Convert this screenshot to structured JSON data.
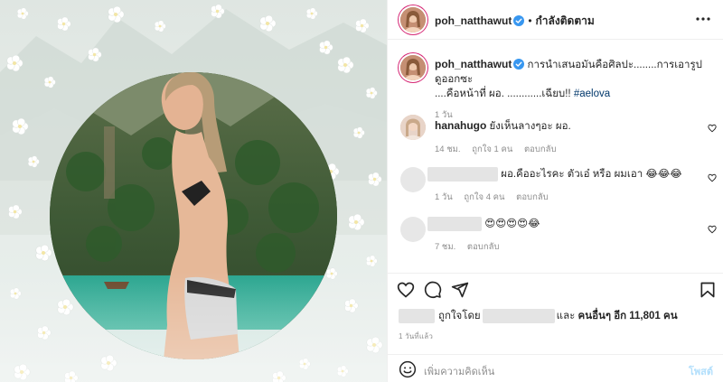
{
  "post": {
    "author": "poh_natthawut",
    "follow_status": "กำลังติดตาม",
    "caption": "การนำเสนอมันคือศิลปะ........การเอารูปดูออกซะ ....คือหน้าที่ ผอ. ............เฉียบ!! ",
    "caption_line1": "การนำเสนอมันคือศิลปะ........การเอารูปดูออกซะ",
    "caption_line2": "....คือหน้าที่ ผอ. ............เฉียบ!!",
    "hashtag": "#aelova",
    "caption_time": "1 วัน"
  },
  "comments": [
    {
      "user": "hanahugo",
      "text": "ยังเห็นลางๆอะ ผอ.",
      "meta": [
        "14 ชม.",
        "ถูกใจ 1 คน",
        "ตอบกลับ"
      ]
    },
    {
      "user": "",
      "text": "ผอ.คืออะไรคะ ตัวเอ๋ หรือ ผมเอา 😂😂😂",
      "meta": [
        "1 วัน",
        "ถูกใจ 4 คน",
        "ตอบกลับ"
      ]
    },
    {
      "user": "",
      "text": "😍😍😍😍😂",
      "meta": [
        "7 ชม.",
        "ตอบกลับ"
      ]
    }
  ],
  "likes": {
    "prefix": "ถูกใจโดย",
    "middle": "และ",
    "suffix": "คนอื่นๆ อีก 11,801 คน"
  },
  "posted_time": "1 วันที่แล้ว",
  "add_comment": {
    "placeholder": "เพิ่มความคิดเห็น",
    "post_label": "โพสต์"
  },
  "icons": [
    "more-options-icon",
    "verified-icon",
    "heart-icon",
    "comment-icon",
    "share-icon",
    "save-icon",
    "emoji-icon"
  ],
  "colors": {
    "hashtag": "#00376b",
    "post_button_disabled": "#b2dffc",
    "verified": "#3897f0",
    "story_ring": "#d62976"
  }
}
